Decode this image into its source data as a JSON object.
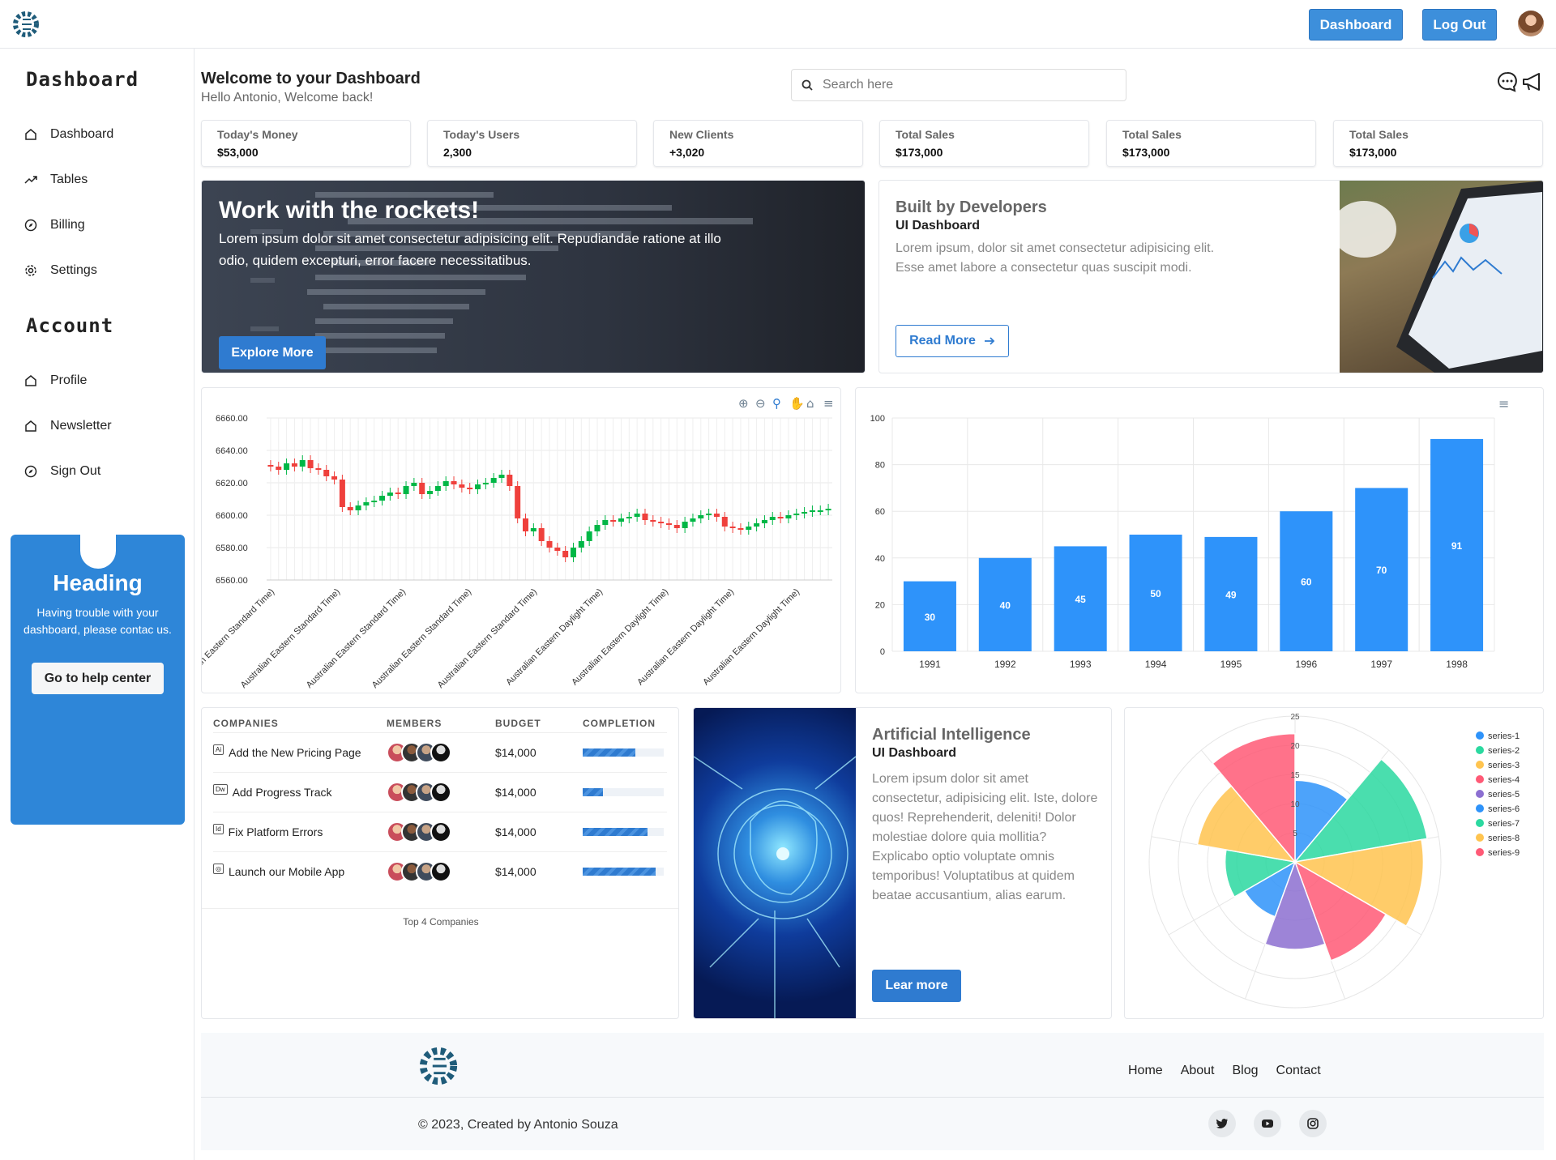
{
  "topbar": {
    "dashboard_btn": "Dashboard",
    "logout_btn": "Log Out"
  },
  "sidebar": {
    "heading_dashboard": "Dashboard",
    "items": [
      {
        "label": "Dashboard",
        "icon": "home-icon"
      },
      {
        "label": "Tables",
        "icon": "trending-icon"
      },
      {
        "label": "Billing",
        "icon": "compass-icon"
      },
      {
        "label": "Settings",
        "icon": "gear-icon"
      }
    ],
    "heading_account": "Account",
    "account_items": [
      {
        "label": "Profile",
        "icon": "home-icon"
      },
      {
        "label": "Newsletter",
        "icon": "home-icon"
      },
      {
        "label": "Sign Out",
        "icon": "compass-icon"
      }
    ],
    "help": {
      "title": "Heading",
      "text": "Having trouble with your dashboard, please contac us.",
      "button": "Go to help center"
    }
  },
  "header": {
    "title": "Welcome to your Dashboard",
    "subtitle": "Hello Antonio, Welcome back!",
    "search_placeholder": "Search here"
  },
  "stats": [
    {
      "label": "Today's Money",
      "value": "$53,000"
    },
    {
      "label": "Today's Users",
      "value": "2,300"
    },
    {
      "label": "New Clients",
      "value": "+3,020"
    },
    {
      "label": "Total Sales",
      "value": "$173,000"
    },
    {
      "label": "Total Sales",
      "value": "$173,000"
    },
    {
      "label": "Total Sales",
      "value": "$173,000"
    }
  ],
  "hero": {
    "title": "Work with the rockets!",
    "text": "Lorem ipsum dolor sit amet consectetur adipisicing elit. Repudiandae ratione at illo odio, quidem excepturi, error facere necessitatibus.",
    "button": "Explore More"
  },
  "built": {
    "title": "Built by Developers",
    "subtitle": "UI Dashboard",
    "text": "Lorem ipsum, dolor sit amet consectetur adipisicing elit. Esse amet labore a consectetur quas suscipit modi.",
    "button": "Read More"
  },
  "chart_data": [
    {
      "type": "candlestick",
      "ylim": [
        6560,
        6660
      ],
      "yticks": [
        "6660.00",
        "6640.00",
        "6620.00",
        "6600.00",
        "6580.00",
        "6560.00"
      ],
      "xticks": [
        "Australian Eastern Standard Time)",
        "Australian Eastern Standard Time)",
        "Australian Eastern Standard Time)",
        "Australian Eastern Standard Time)",
        "Australian Eastern Standard Time)",
        "Australian Eastern Daylight Time)",
        "Australian Eastern Daylight Time)",
        "Australian Eastern Daylight Time)",
        "Australian Eastern Daylight Time)"
      ],
      "closes": [
        6630,
        6628,
        6632,
        6630,
        6634,
        6629,
        6628,
        6624,
        6622,
        6605,
        6603,
        6606,
        6608,
        6609,
        6612,
        6614,
        6613,
        6618,
        6620,
        6613,
        6615,
        6618,
        6621,
        6619,
        6617,
        6616,
        6619,
        6620,
        6623,
        6625,
        6618,
        6598,
        6590,
        6592,
        6584,
        6580,
        6578,
        6574,
        6580,
        6584,
        6590,
        6594,
        6597,
        6596,
        6598,
        6599,
        6601,
        6597,
        6596,
        6595,
        6594,
        6592,
        6596,
        6598,
        6600,
        6601,
        6599,
        6593,
        6592,
        6591,
        6593,
        6595,
        6597,
        6599,
        6598,
        6600,
        6601,
        6602,
        6603,
        6603,
        6604
      ]
    },
    {
      "type": "bar",
      "categories": [
        "1991",
        "1992",
        "1993",
        "1994",
        "1995",
        "1996",
        "1997",
        "1998"
      ],
      "values": [
        30,
        40,
        45,
        50,
        49,
        60,
        70,
        91
      ],
      "ylim": [
        0,
        100
      ],
      "yticks": [
        "0",
        "20",
        "40",
        "60",
        "80",
        "100"
      ]
    },
    {
      "type": "polar-area",
      "ylim": [
        0,
        25
      ],
      "ticks": [
        "25",
        "20",
        "15",
        "10",
        "5"
      ],
      "series": [
        {
          "name": "series-1",
          "value": 14,
          "color": "#2e93fa"
        },
        {
          "name": "series-2",
          "value": 23,
          "color": "#2bd9a0"
        },
        {
          "name": "series-3",
          "value": 22,
          "color": "#ffc44f"
        },
        {
          "name": "series-4",
          "value": 18,
          "color": "#ff5a76"
        },
        {
          "name": "series-5",
          "value": 15,
          "color": "#8c6fd1"
        },
        {
          "name": "series-6",
          "value": 10,
          "color": "#2e93fa"
        },
        {
          "name": "series-7",
          "value": 12,
          "color": "#2bd9a0"
        },
        {
          "name": "series-8",
          "value": 17,
          "color": "#ffc44f"
        },
        {
          "name": "series-9",
          "value": 22,
          "color": "#ff5a76"
        }
      ]
    }
  ],
  "companies": {
    "headers": [
      "COMPANIES",
      "MEMBERS",
      "BUDGET",
      "COMPLETION"
    ],
    "rows": [
      {
        "name": "Add the New Pricing Page",
        "budget": "$14,000",
        "completion": 0.65
      },
      {
        "name": "Add Progress Track",
        "budget": "$14,000",
        "completion": 0.25
      },
      {
        "name": "Fix Platform Errors",
        "budget": "$14,000",
        "completion": 0.8
      },
      {
        "name": "Launch our Mobile App",
        "budget": "$14,000",
        "completion": 0.9
      }
    ],
    "caption": "Top 4 Companies"
  },
  "ai": {
    "title": "Artificial Intelligence",
    "subtitle": "UI Dashboard",
    "text": "Lorem ipsum dolor sit amet consectetur, adipisicing elit. Iste, dolore quos! Reprehenderit, deleniti! Dolor molestiae dolore quia mollitia? Explicabo optio voluptate omnis temporibus! Voluptatibus at quidem beatae accusantium, alias earum.",
    "button": "Lear more"
  },
  "footer": {
    "nav": [
      "Home",
      "About",
      "Blog",
      "Contact"
    ],
    "copyright": "© 2023, Created by Antonio Souza"
  }
}
